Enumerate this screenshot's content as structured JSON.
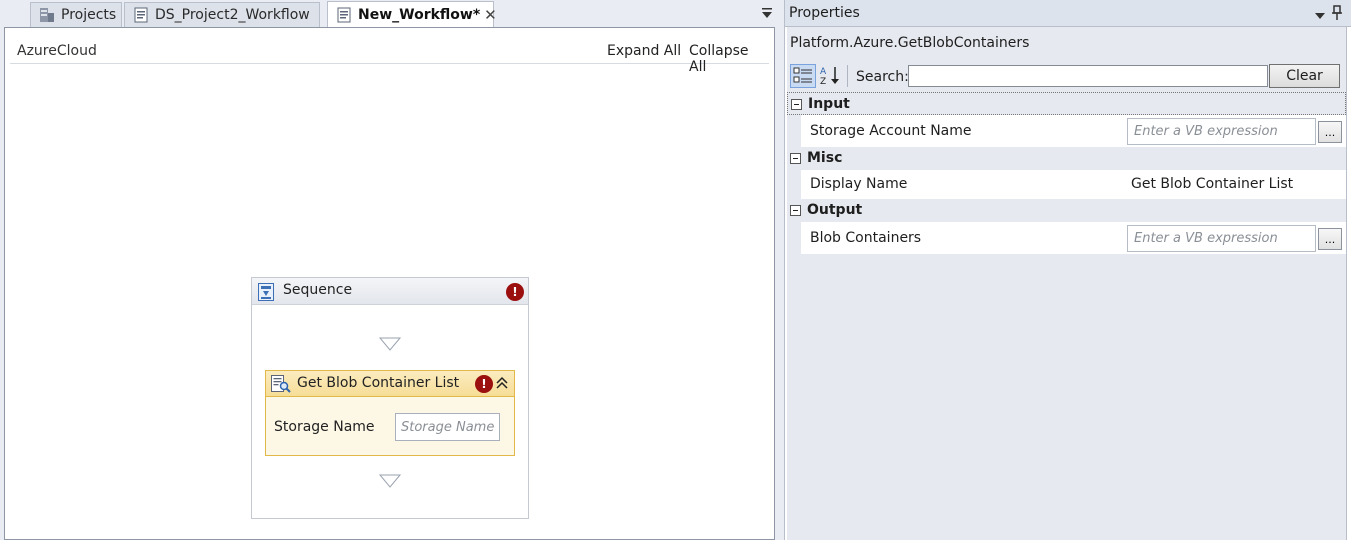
{
  "tabs": [
    {
      "label": "Projects",
      "icon": "projects-icon",
      "active": false
    },
    {
      "label": "DS_Project2_Workflow",
      "icon": "workflow-file-icon",
      "active": false
    },
    {
      "label": "New_Workflow*",
      "icon": "workflow-file-icon",
      "active": true
    }
  ],
  "designer": {
    "breadcrumb": "AzureCloud",
    "expand_all": "Expand All",
    "collapse_all": "Collapse All",
    "sequence": {
      "title": "Sequence",
      "error_glyph": "!"
    },
    "activity": {
      "title": "Get Blob Container List",
      "error_glyph": "!",
      "field_label": "Storage Name",
      "field_placeholder": "Storage Name"
    }
  },
  "properties": {
    "title": "Properties",
    "type_name": "Platform.Azure.GetBlobContainers",
    "search_label": "Search:",
    "search_value": "",
    "clear_label": "Clear",
    "categories": [
      {
        "name": "Input",
        "rows": [
          {
            "name": "Storage Account Name",
            "value": "",
            "placeholder": "Enter a VB expression",
            "ellipsis": "..."
          }
        ]
      },
      {
        "name": "Misc",
        "rows": [
          {
            "name": "Display Name",
            "value": "Get Blob Container List"
          }
        ]
      },
      {
        "name": "Output",
        "rows": [
          {
            "name": "Blob Containers",
            "value": "",
            "placeholder": "Enter a VB expression",
            "ellipsis": "..."
          }
        ]
      }
    ]
  },
  "colors": {
    "activity_header": "#f6dd97",
    "activity_border": "#e3b84b",
    "error_badge": "#9b0f0f",
    "selected_toggle": "#c9daf3"
  }
}
